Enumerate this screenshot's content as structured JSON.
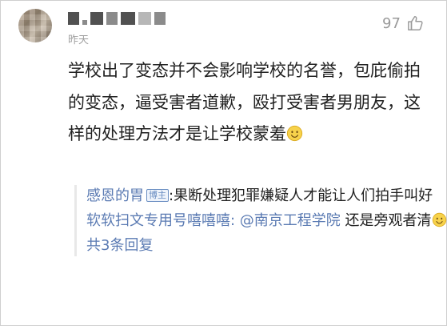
{
  "post": {
    "username_redacted": true,
    "time": "昨天",
    "like_count": "97",
    "like_icon": "thumbs-up-icon",
    "comment_text": "学校出了变态并不会影响学校的名誉，包庇偷拍的变态，逼受害者道歉，殴打受害者男朋友，这样的处理方法才是让学校蒙羞",
    "emoji": "smile-emoji"
  },
  "replies": [
    {
      "user": "感恩的胃",
      "badge": "博主",
      "text": ":果断处理犯罪嫌疑人才能让人们拍手叫好"
    },
    {
      "user": "软软扫文专用号嘻嘻嘻:",
      "mention": " @南京工程学院",
      "text": " 还是旁观者清",
      "emoji": "smile-emoji"
    }
  ],
  "more_replies": "共3条回复",
  "colors": {
    "link": "#5b7bb3",
    "meta": "#a0a0a0",
    "text": "#222222"
  }
}
